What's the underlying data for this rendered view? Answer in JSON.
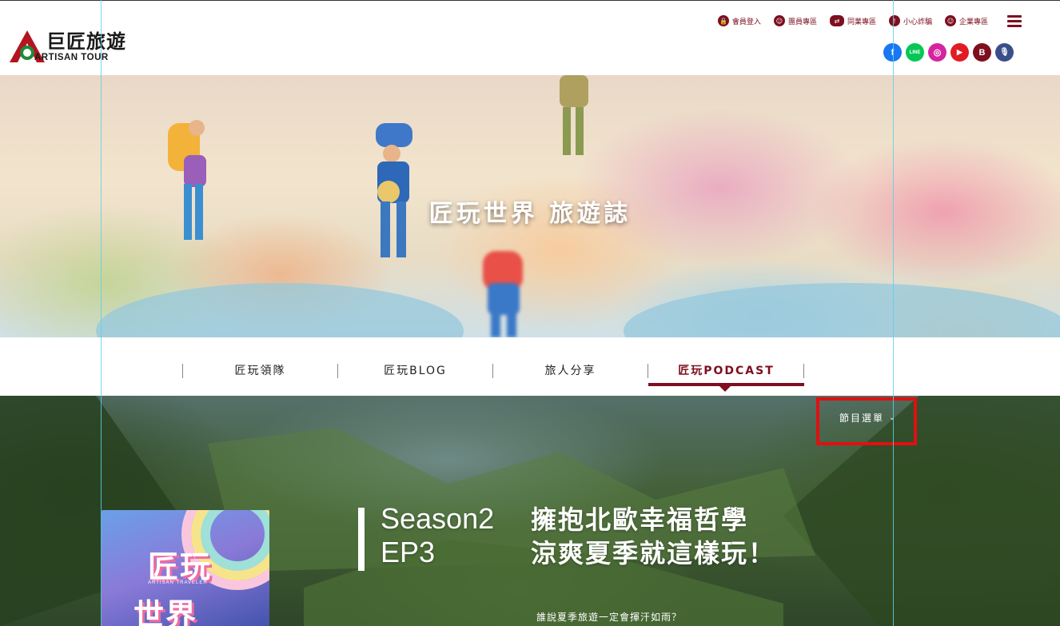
{
  "brand": {
    "name_cn": "巨匠旅遊",
    "name_en": "ARTISAN TOUR",
    "color": "#7d0f1f"
  },
  "topnav": [
    {
      "label": "會員登入",
      "icon": "lock-icon"
    },
    {
      "label": "團員專區",
      "icon": "group-icon"
    },
    {
      "label": "同業專區",
      "icon": "partner-icon"
    },
    {
      "label": "小心詐騙",
      "icon": "warning-icon"
    },
    {
      "label": "企業專區",
      "icon": "enterprise-icon"
    }
  ],
  "social": [
    {
      "name": "facebook-icon",
      "glyph": "f",
      "color": "#1877f2"
    },
    {
      "name": "line-icon",
      "glyph": "LINE",
      "color": "#06c755"
    },
    {
      "name": "instagram-icon",
      "glyph": "◎",
      "color": "#d6249f"
    },
    {
      "name": "youtube-icon",
      "glyph": "▶",
      "color": "#e31b23"
    },
    {
      "name": "blog-icon",
      "glyph": "B",
      "color": "#7d0f1f"
    },
    {
      "name": "podcast-icon",
      "glyph": "🎙",
      "color": "#3a4f8a"
    }
  ],
  "hero": {
    "title": "匠玩世界 旅遊誌"
  },
  "tabs": [
    {
      "label": "匠玩領隊",
      "active": false
    },
    {
      "label": "匠玩BLOG",
      "active": false
    },
    {
      "label": "旅人分享",
      "active": false
    },
    {
      "label": "匠玩PODCAST",
      "active": true
    }
  ],
  "podcast": {
    "program_menu": "節目選單",
    "season": "Season2",
    "episode": "EP3",
    "title_line1": "擁抱北歐幸福哲學",
    "title_line2": "涼爽夏季就這樣玩！",
    "description": "誰說夏季旅遊一定會揮汗如雨？",
    "cover": {
      "line1": "匠玩",
      "line2": "世界",
      "tag": "ARTISAN TRAVELER"
    }
  }
}
